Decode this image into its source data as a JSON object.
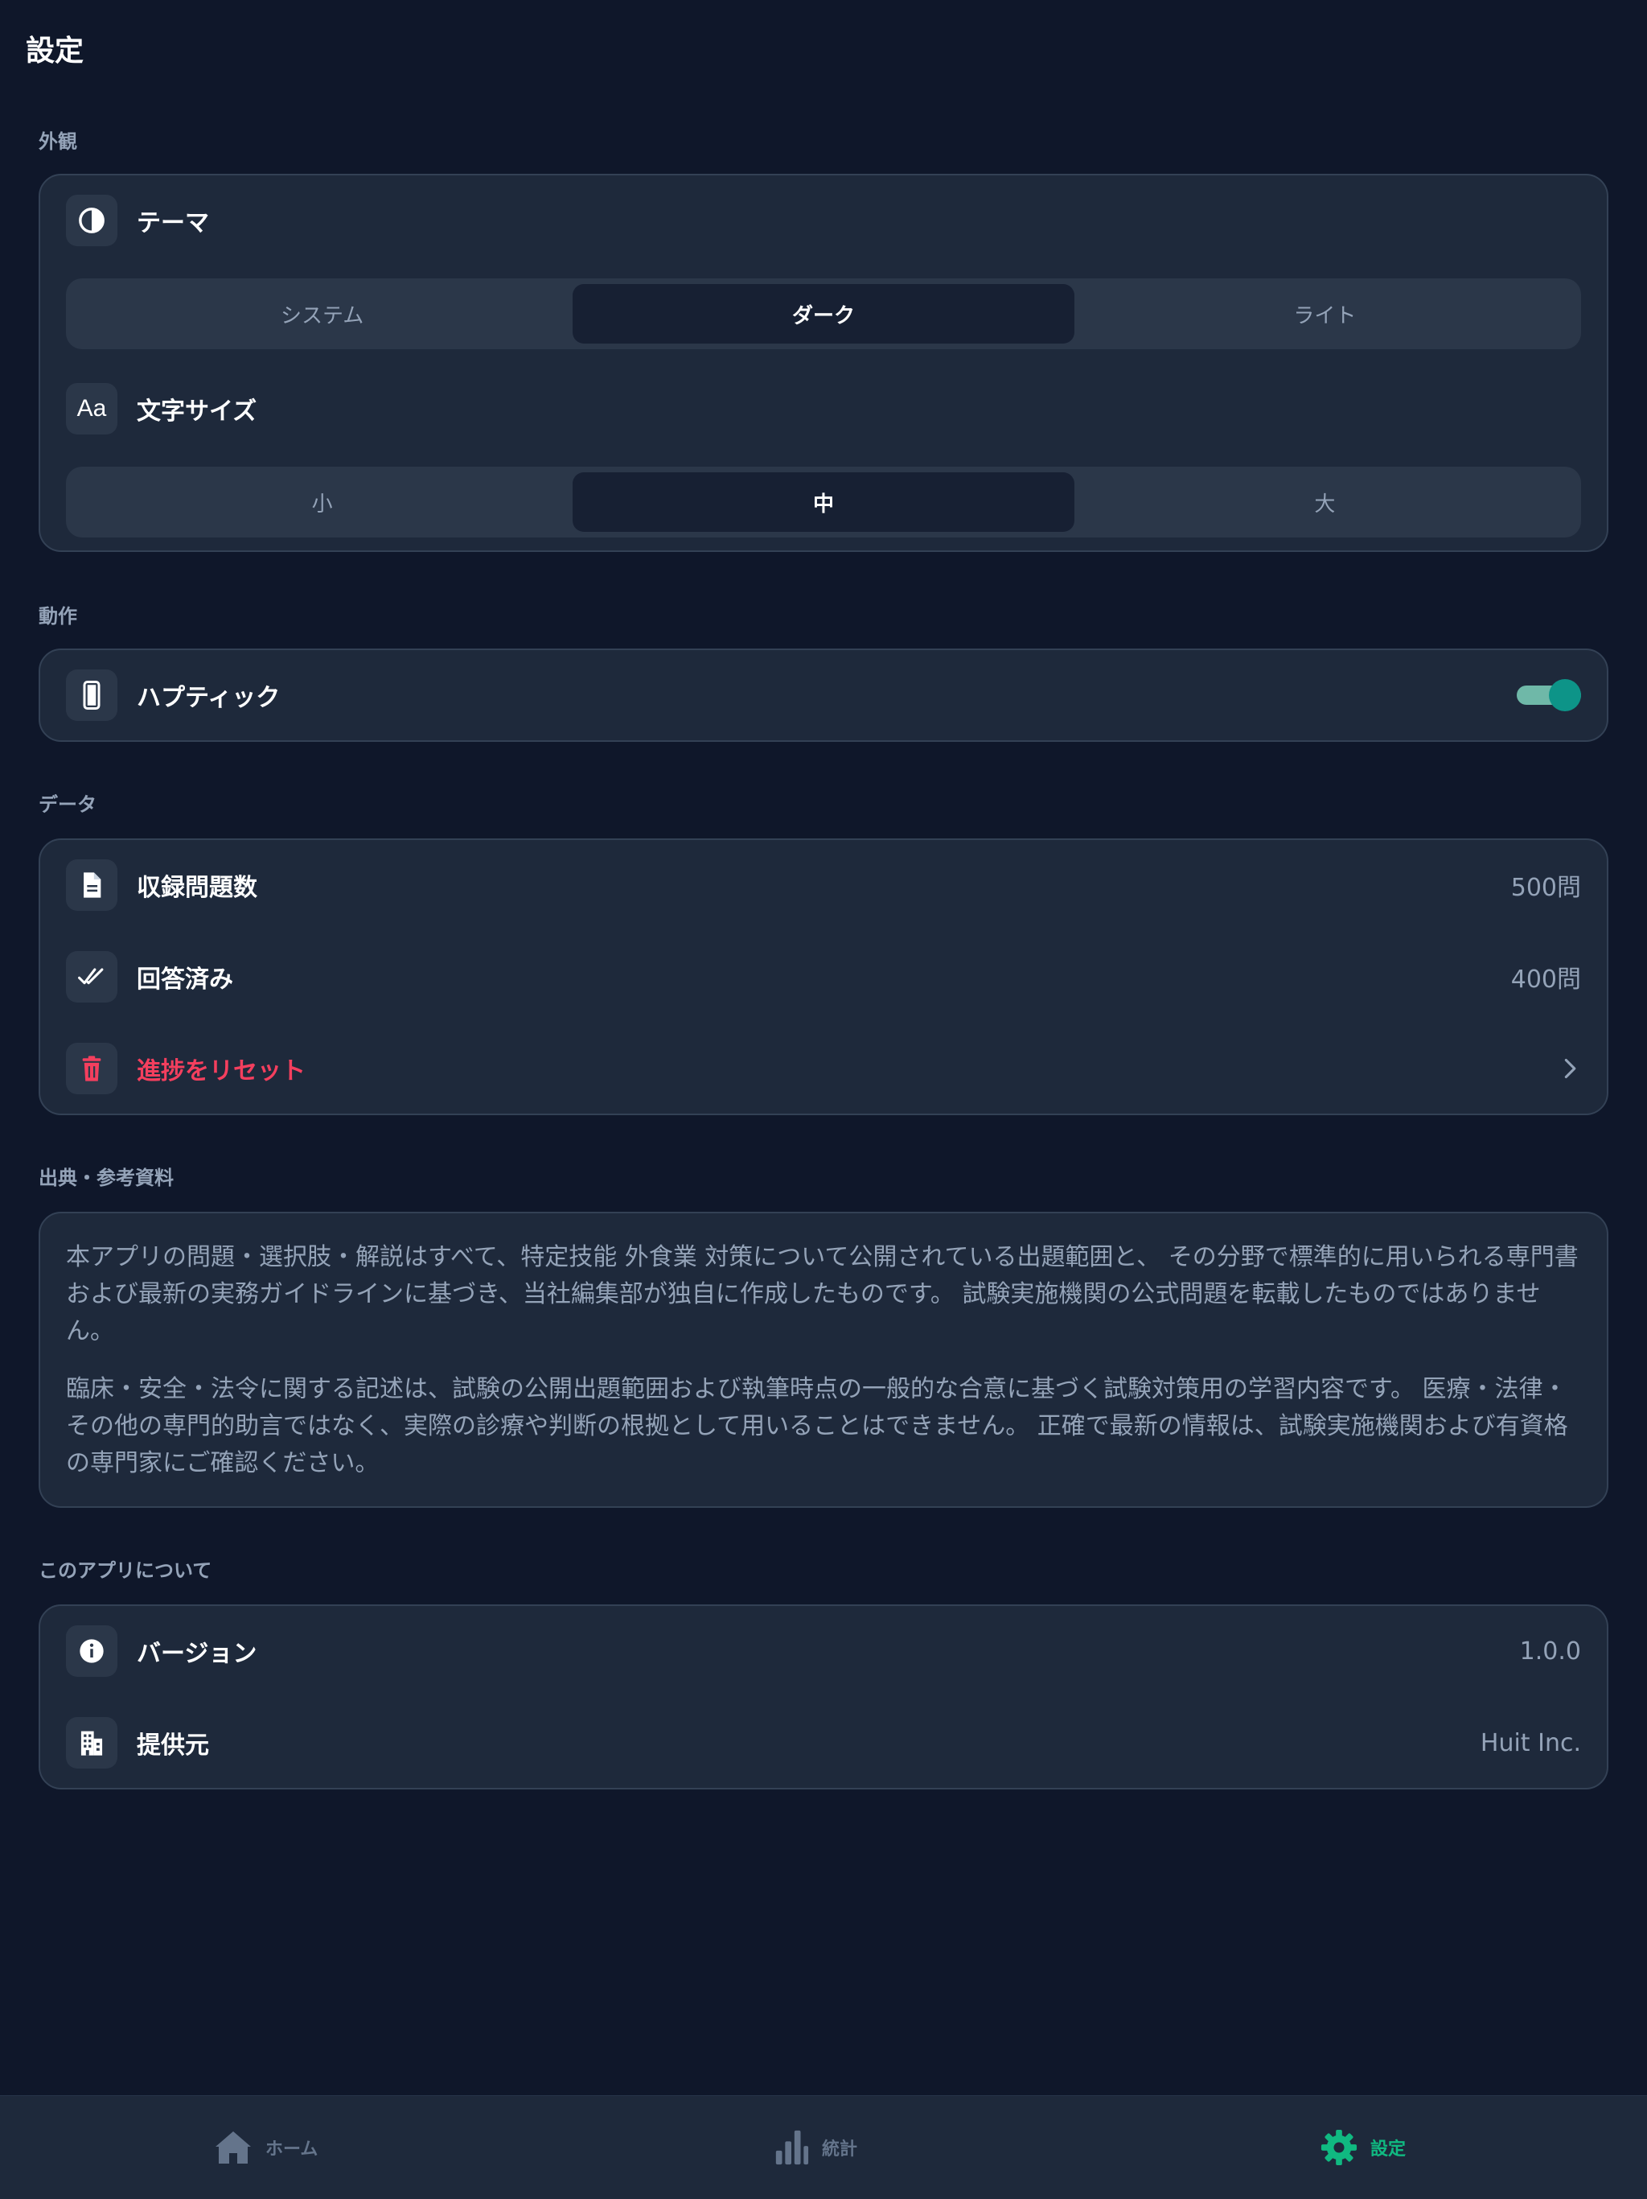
{
  "header": {
    "title": "設定"
  },
  "appearance": {
    "section_label": "外観",
    "theme": {
      "label": "テーマ",
      "icon": "half-circle-contrast-icon",
      "options": [
        "システム",
        "ダーク",
        "ライト"
      ],
      "selected": "ダーク"
    },
    "text_size": {
      "label": "文字サイズ",
      "icon_text": "Aa",
      "options": [
        "小",
        "中",
        "大"
      ],
      "selected": "中"
    }
  },
  "behavior": {
    "section_label": "動作",
    "haptic": {
      "label": "ハプティック",
      "icon": "phone-icon",
      "enabled": true
    }
  },
  "data": {
    "section_label": "データ",
    "total_questions": {
      "label": "収録問題数",
      "value": "500問",
      "icon": "document-icon"
    },
    "answered": {
      "label": "回答済み",
      "value": "400問",
      "icon": "double-check-icon"
    },
    "reset": {
      "label": "進捗をリセット",
      "icon": "trash-icon"
    }
  },
  "references": {
    "section_label": "出典・参考資料",
    "paragraph1": "本アプリの問題・選択肢・解説はすべて、特定技能 外食業 対策について公開されている出題範囲と、 その分野で標準的に用いられる専門書および最新の実務ガイドラインに基づき、当社編集部が独自に作成したものです。 試験実施機関の公式問題を転載したものではありません。",
    "paragraph2": "臨床・安全・法令に関する記述は、試験の公開出題範囲および執筆時点の一般的な合意に基づく試験対策用の学習内容です。 医療・法律・その他の専門的助言ではなく、実際の診療や判断の根拠として用いることはできません。 正確で最新の情報は、試験実施機関および有資格の専門家にご確認ください。"
  },
  "about": {
    "section_label": "このアプリについて",
    "version": {
      "label": "バージョン",
      "value": "1.0.0",
      "icon": "info-icon"
    },
    "provider": {
      "label": "提供元",
      "value": "Huit Inc.",
      "icon": "building-icon"
    }
  },
  "tabbar": {
    "items": [
      {
        "label": "ホーム",
        "icon": "home-icon"
      },
      {
        "label": "統計",
        "icon": "bar-chart-icon"
      },
      {
        "label": "設定",
        "icon": "gear-icon"
      }
    ],
    "active": "設定"
  },
  "colors": {
    "background": "#0f172a",
    "card": "#1e293b",
    "accent": "#10b981",
    "danger": "#f43f5e",
    "toggle_on": "#0d9488"
  }
}
